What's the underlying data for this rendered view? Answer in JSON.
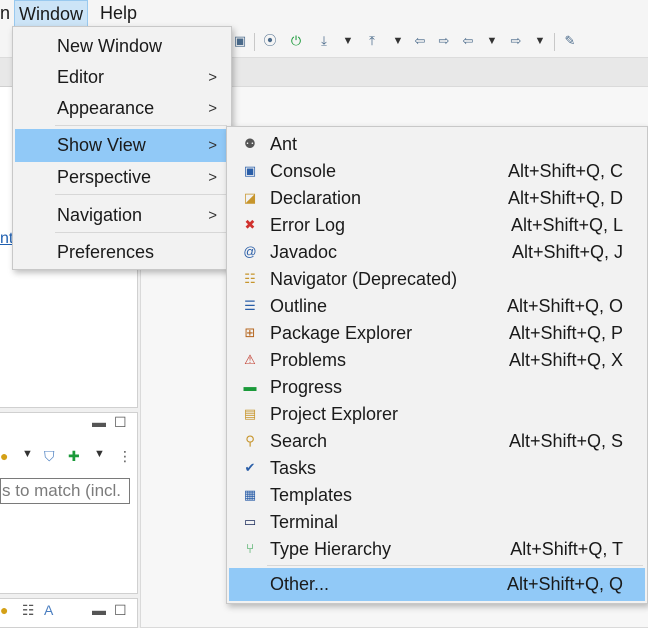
{
  "menubar": {
    "items": [
      {
        "label": "n"
      },
      {
        "label": "Window"
      },
      {
        "label": "Help"
      }
    ]
  },
  "background": {
    "link_fragment": "nt",
    "filter_placeholder": "s to match (incl."
  },
  "window_menu": {
    "items": [
      {
        "label": "New Window",
        "submenu": false
      },
      {
        "label": "Editor",
        "submenu": true
      },
      {
        "label": "Appearance",
        "submenu": true
      },
      {
        "label": "Show View",
        "submenu": true,
        "selected": true
      },
      {
        "label": "Perspective",
        "submenu": true
      },
      {
        "label": "Navigation",
        "submenu": true
      },
      {
        "label": "Preferences",
        "submenu": false
      }
    ],
    "submenu_arrow": ">"
  },
  "show_view_menu": {
    "items": [
      {
        "label": "Ant",
        "accel": "",
        "icon": "ant-icon",
        "glyph": "⚉"
      },
      {
        "label": "Console",
        "accel": "Alt+Shift+Q, C",
        "icon": "console-icon",
        "glyph": "▣"
      },
      {
        "label": "Declaration",
        "accel": "Alt+Shift+Q, D",
        "icon": "declaration-icon",
        "glyph": "◪"
      },
      {
        "label": "Error Log",
        "accel": "Alt+Shift+Q, L",
        "icon": "error-log-icon",
        "glyph": "✖"
      },
      {
        "label": "Javadoc",
        "accel": "Alt+Shift+Q, J",
        "icon": "javadoc-icon",
        "glyph": "@"
      },
      {
        "label": "Navigator (Deprecated)",
        "accel": "",
        "icon": "navigator-icon",
        "glyph": "☷"
      },
      {
        "label": "Outline",
        "accel": "Alt+Shift+Q, O",
        "icon": "outline-icon",
        "glyph": "☰"
      },
      {
        "label": "Package Explorer",
        "accel": "Alt+Shift+Q, P",
        "icon": "package-explorer-icon",
        "glyph": "⊞"
      },
      {
        "label": "Problems",
        "accel": "Alt+Shift+Q, X",
        "icon": "problems-icon",
        "glyph": "⚠"
      },
      {
        "label": "Progress",
        "accel": "",
        "icon": "progress-icon",
        "glyph": "▬"
      },
      {
        "label": "Project Explorer",
        "accel": "",
        "icon": "project-explorer-icon",
        "glyph": "▤"
      },
      {
        "label": "Search",
        "accel": "Alt+Shift+Q, S",
        "icon": "search-icon",
        "glyph": "⚲"
      },
      {
        "label": "Tasks",
        "accel": "",
        "icon": "tasks-icon",
        "glyph": "✔"
      },
      {
        "label": "Templates",
        "accel": "",
        "icon": "templates-icon",
        "glyph": "▦"
      },
      {
        "label": "Terminal",
        "accel": "",
        "icon": "terminal-icon",
        "glyph": "▭"
      },
      {
        "label": "Type Hierarchy",
        "accel": "Alt+Shift+Q, T",
        "icon": "type-hierarchy-icon",
        "glyph": "⑂"
      },
      {
        "label": "Other...",
        "accel": "Alt+Shift+Q, Q",
        "icon": "",
        "glyph": "",
        "selected": true
      }
    ]
  },
  "colors": {
    "menu_highlight": "#91c9f7",
    "menubar_selected": "#cce4f7",
    "link": "#1f5fb0"
  }
}
